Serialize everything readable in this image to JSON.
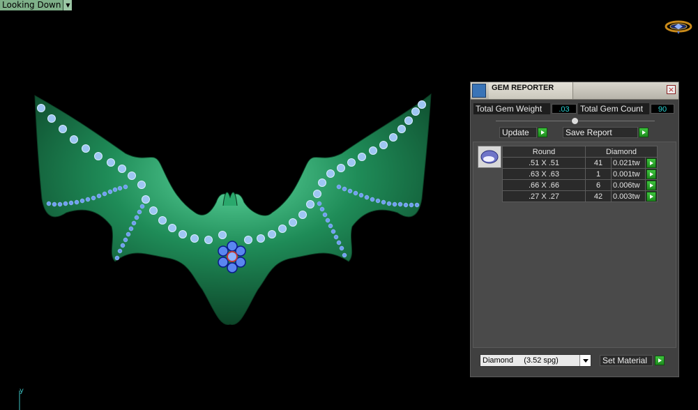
{
  "viewport": {
    "view_label": "Looking Down",
    "axis_label": "y",
    "model_color": "#1e8a56",
    "gem_color": "#9ec6f3",
    "accent_gem_color": "#3d6ef2"
  },
  "panel": {
    "title": "GEM REPORTER",
    "total_gem_weight_label": "Total Gem Weight",
    "total_gem_weight_value": ".03",
    "total_gem_count_label": "Total Gem Count",
    "total_gem_count_value": "90",
    "update_label": "Update",
    "save_report_label": "Save Report",
    "table": {
      "shape_header": "Round",
      "material_header": "Diamond",
      "rows": [
        {
          "size": ".51 X .51",
          "count": "41",
          "weight": "0.021tw"
        },
        {
          "size": ".63 X .63",
          "count": "1",
          "weight": "0.001tw"
        },
        {
          "size": ".66 X .66",
          "count": "6",
          "weight": "0.006tw"
        },
        {
          "size": ".27 X .27",
          "count": "42",
          "weight": "0.003tw"
        }
      ]
    },
    "material_select_value": "Diamond     (3.52 spg)",
    "set_material_label": "Set Material"
  }
}
